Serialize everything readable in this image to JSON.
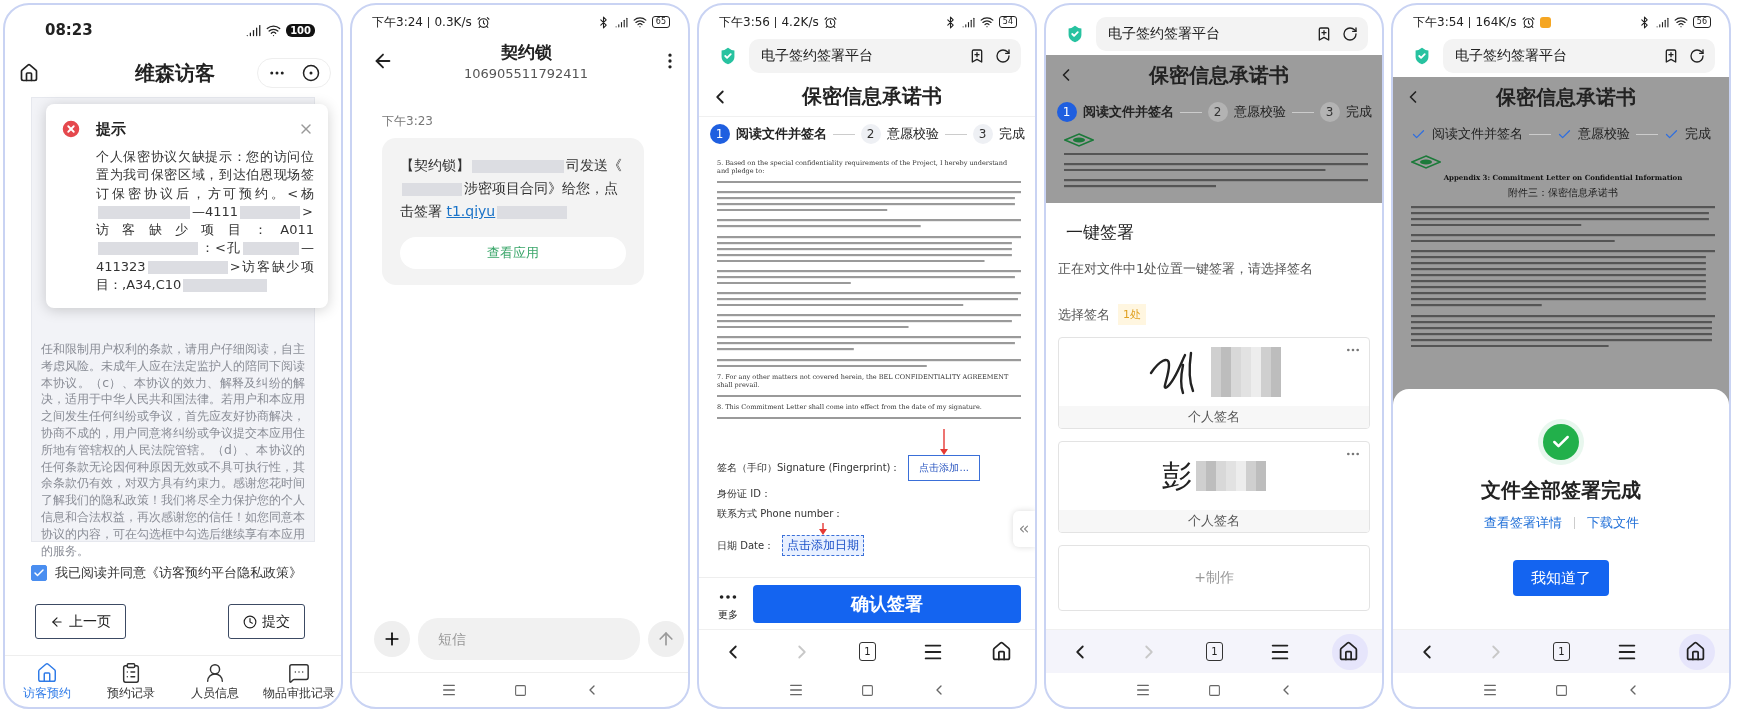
{
  "visitor_app": {
    "status_bar": {
      "time": "08:23",
      "battery": "100"
    },
    "title": "维森访客",
    "agreement_text": "任和限制用户权利的条款，请用户仔细阅读，自主考虑风险。未成年人应在法定监护人的陪同下阅读本协议。（c）、本协议的效力、解释及纠纷的解决，适用于中华人民共和国法律。若用户和本应用之间发生任何纠纷或争议，首先应友好协商解决，协商不成的，用户同意将纠纷或争议提交本应用住所地有管辖权的人民法院管辖。（d）、本协议的任何条款无论因何种原因无效或不具可执行性，其余条款仍有效，对双方具有约束力。感谢您花时间了解我们的隐私政策！我们将尽全力保护您的个人信息和合法权益，再次感谢您的信任！如您同意本协议的内容，可在勾选框中勾选后继续享有本应用的服务。",
    "dialog": {
      "title": "提示",
      "body": [
        {
          "kind": "text",
          "text": "个人保密协议欠缺提示：您的访问位置为我司保密区域，到达伯恩现场签订保密协议后，方可预约。<杨"
        },
        {
          "kind": "redacted"
        },
        {
          "kind": "text",
          "text": "—4111"
        },
        {
          "kind": "redacted"
        },
        {
          "kind": "text",
          "text": ">访客缺少项目：A011"
        },
        {
          "kind": "redacted"
        },
        {
          "kind": "text",
          "text": "：<孔"
        },
        {
          "kind": "redacted"
        },
        {
          "kind": "text",
          "text": "—411323"
        },
        {
          "kind": "redacted"
        },
        {
          "kind": "text",
          "text": ">访客缺少项目：,A34,C10"
        },
        {
          "kind": "redacted"
        }
      ]
    },
    "consent": {
      "checked": true,
      "label": "我已阅读并同意《访客预约平台隐私政策》"
    },
    "buttons": [
      {
        "kind": "back",
        "label": "上一页"
      },
      {
        "kind": "submit",
        "label": "提交"
      }
    ],
    "tabs": [
      {
        "kind": "home",
        "label": "访客预约",
        "selected": true
      },
      {
        "kind": "records",
        "label": "预约记录",
        "selected": false
      },
      {
        "kind": "person",
        "label": "人员信息",
        "selected": false
      },
      {
        "kind": "chat",
        "label": "物品审批记录",
        "selected": false
      }
    ]
  },
  "sms_app": {
    "status_bar": {
      "time": "下午3:24",
      "speed": "0.3K/s",
      "battery": "65"
    },
    "title": "契约锁",
    "number": "106905511792411",
    "time": "下午3:23",
    "message": [
      {
        "kind": "text",
        "text": "【契约锁】"
      },
      {
        "kind": "redacted"
      },
      {
        "kind": "text",
        "text": "司发送《"
      },
      {
        "kind": "redacted"
      },
      {
        "kind": "text",
        "text": "涉密项目合同》给您，点击签署 "
      },
      {
        "kind": "link",
        "text": "t1.qiyu"
      },
      {
        "kind": "redacted"
      }
    ],
    "action": "查看应用",
    "input_placeholder": "短信"
  },
  "sign_page": {
    "status_bar": {
      "time": "下午3:56",
      "speed": "4.2K/s",
      "battery": "54"
    },
    "url_title": "电子签约签署平台",
    "title": "保密信息承诺书",
    "steps": [
      {
        "number": "1",
        "label": "阅读文件并签名",
        "current": true
      },
      {
        "number": "2",
        "label": "意愿校验",
        "current": false
      },
      {
        "number": "3",
        "label": "完成",
        "current": false
      }
    ],
    "doc": {
      "clauses": [
        "5. Based on the special confidentiality requirements of the Project, I hereby understand and pledge to:",
        "7. For any other matters not covered herein, the BEL CONFIDENTIALITY AGREEMENT shall prevail.",
        "8. This Commitment Letter shall come into effect from the date of my signature."
      ],
      "signature_fields": [
        "签名（手印）Signature (Fingerprint)：",
        "身份证 ID：",
        "联系方式 Phone number：",
        "日期 Date："
      ],
      "sign_button": "点击添加...",
      "date_button": "点击添加日期"
    },
    "more_label": "更多",
    "confirm_label": "确认签署",
    "browser_nav": {
      "tab_count": "1",
      "forward_disabled": true
    }
  },
  "one_click_sign": {
    "url_title": "电子签约签署平台",
    "page_title": "保密信息承诺书",
    "steps": [
      {
        "number": "1",
        "label": "阅读文件并签名",
        "current": true
      },
      {
        "number": "2",
        "label": "意愿校验",
        "current": false
      },
      {
        "number": "3",
        "label": "完成",
        "current": false
      }
    ],
    "sheet": {
      "title": "一键签署",
      "description": "正在对文件中1处位置一键签署，请选择签名",
      "choose_label": "选择签名",
      "count_badge": "1处",
      "signatures": [
        {
          "kind": "handwritten",
          "label": "个人签名"
        },
        {
          "kind": "typed",
          "text": "彭",
          "label": "个人签名"
        }
      ],
      "create_label": "+制作"
    },
    "browser_nav": {
      "tab_count": "1",
      "forward_disabled": true
    }
  },
  "sign_complete": {
    "status_bar": {
      "time": "下午3:54",
      "speed": "164K/s",
      "battery": "56",
      "notification": true
    },
    "url_title": "电子签约签署平台",
    "page_title": "保密信息承诺书",
    "steps": [
      {
        "label": "阅读文件并签名",
        "done": true
      },
      {
        "label": "意愿校验",
        "done": true
      },
      {
        "label": "完成",
        "done": true
      }
    ],
    "doc": {
      "appendix_title": "Appendix 3: Commitment Letter on Confidential Information",
      "appendix_subtitle": "附件三：保密信息承诺书"
    },
    "sheet": {
      "title": "文件全部签署完成",
      "links": [
        "查看签署详情",
        "下载文件"
      ],
      "button": "我知道了"
    },
    "browser_nav": {
      "tab_count": "1",
      "forward_disabled": true
    }
  }
}
